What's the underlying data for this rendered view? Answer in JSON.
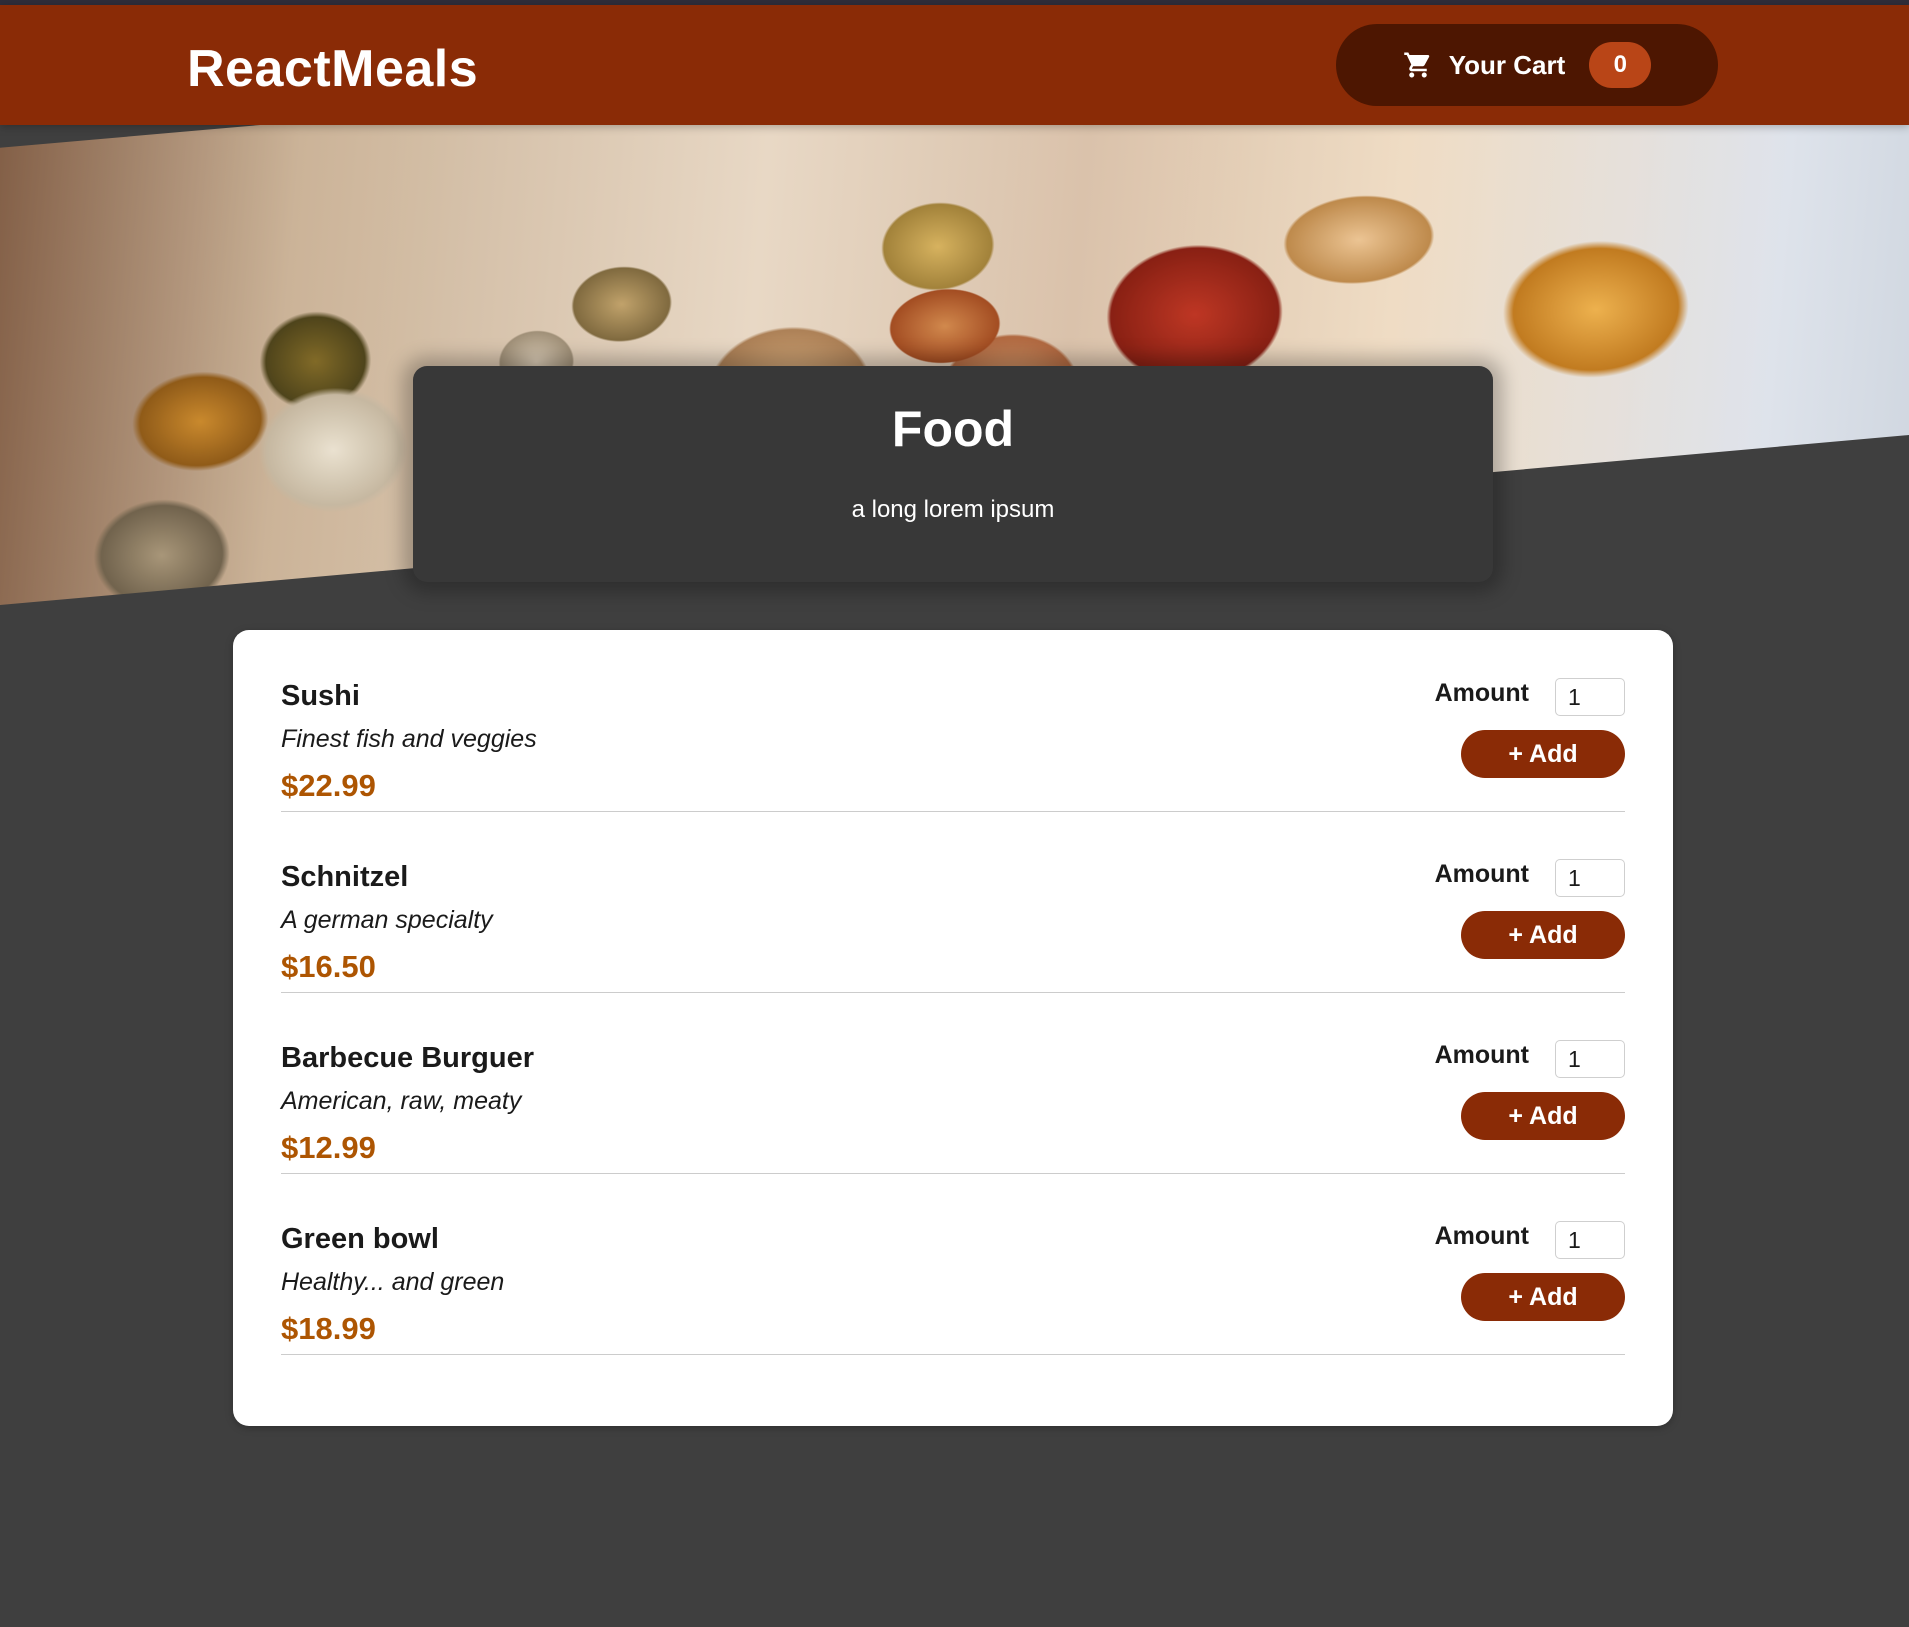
{
  "header": {
    "logo": "ReactMeals",
    "cart_label": "Your Cart",
    "cart_count": "0",
    "cart_icon": "cart-icon"
  },
  "summary": {
    "title": "Food",
    "text": "a long lorem ipsum"
  },
  "meals": [
    {
      "name": "Sushi",
      "description": "Finest fish and veggies",
      "price": "$22.99",
      "amount_label": "Amount",
      "amount": "1",
      "add_label": "+ Add"
    },
    {
      "name": "Schnitzel",
      "description": "A german specialty",
      "price": "$16.50",
      "amount_label": "Amount",
      "amount": "1",
      "add_label": "+ Add"
    },
    {
      "name": "Barbecue Burguer",
      "description": "American, raw, meaty",
      "price": "$12.99",
      "amount_label": "Amount",
      "amount": "1",
      "add_label": "+ Add"
    },
    {
      "name": "Green bowl",
      "description": "Healthy... and green",
      "price": "$18.99",
      "amount_label": "Amount",
      "amount": "1",
      "add_label": "+ Add"
    }
  ],
  "colors": {
    "header": "#8a2b06",
    "cart_button": "#4d1601",
    "badge": "#b94517",
    "price": "#ad5502",
    "background": "#3f3f3f"
  }
}
